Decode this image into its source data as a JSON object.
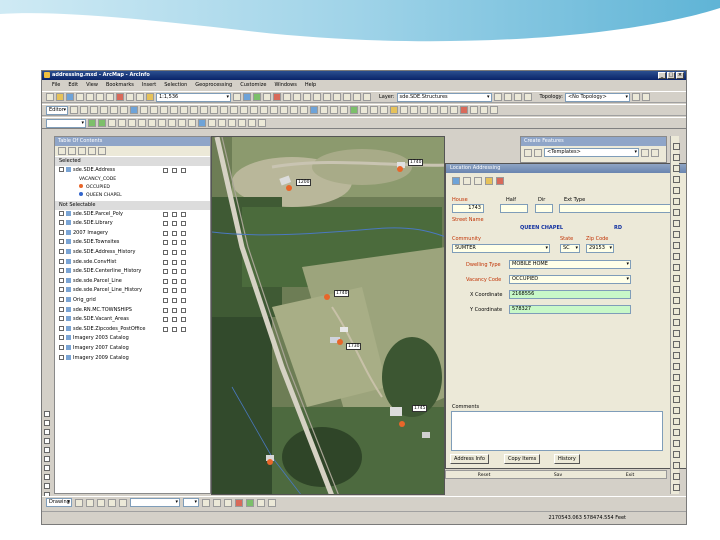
{
  "window": {
    "title": "addressing.mxd - ArcMap - ArcInfo"
  },
  "menu": [
    "File",
    "Edit",
    "View",
    "Bookmarks",
    "Insert",
    "Selection",
    "Geoprocessing",
    "Customize",
    "Windows",
    "Help"
  ],
  "toolbar": {
    "scale": "1:1,536",
    "layer_label": "Layer:",
    "layer_value": "sde.SDE.Structures",
    "topology_label": "Topology:",
    "topology_value": "<No Topology>",
    "editor_label": "Editor",
    "draw_label": "Drawing"
  },
  "toc": {
    "title": "Table Of Contents",
    "groups": [
      {
        "name": "Selected",
        "layers": [
          {
            "name": "sde.SDE.Address",
            "symbols": [
              "VACANCY_CODE",
              "OCCUPIED",
              "QUEEN CHAPEL"
            ]
          }
        ]
      },
      {
        "name": "Not Selectable",
        "layers": [
          {
            "name": "sde.SDE.Parcel_Poly"
          },
          {
            "name": "sde.SDE.Library"
          },
          {
            "name": "2007 Imagery"
          },
          {
            "name": "sde.SDE.Townsites"
          },
          {
            "name": "sde.SDE.Address_History"
          },
          {
            "name": "sde.sde.ConvHist"
          },
          {
            "name": "sde.SDE.Centerline_History"
          },
          {
            "name": "sde.sde.Parcel_Line"
          },
          {
            "name": "sde.sde.Parcel_Line_History"
          },
          {
            "name": "Orig_grid"
          },
          {
            "name": "sde.RN.MC.TOWNSHIPS"
          },
          {
            "name": "sde.SDE.Vacant_Areas"
          },
          {
            "name": "sde.SDE.Zipcodes_PostOffice"
          },
          {
            "name": "Imagery 2003 Catalog"
          },
          {
            "name": "Imagery 2007 Catalog"
          },
          {
            "name": "Imagery 2009 Catalog"
          }
        ]
      }
    ]
  },
  "catalog": {
    "title": "Create Features",
    "dropdown": "<Templates>"
  },
  "map": {
    "address_tags": [
      "1200",
      "1740",
      "1740",
      "1730",
      "1745"
    ]
  },
  "form": {
    "title": "Location Addressing",
    "house_label": "House",
    "house_value": "1743",
    "half_label": "Half",
    "dir_label": "Dir",
    "street_type_label": "Ext Type",
    "street_name_label": "Street Name",
    "street_name_value": "QUEEN CHAPEL",
    "street_suffix_value": "RD",
    "community_label": "Community",
    "state_label": "State",
    "zip_label": "Zip Code",
    "community_value": "SUMTER",
    "state_value": "SC",
    "zip_value": "29153",
    "dwelling_label": "Dwelling Type",
    "dwelling_value": "MOBILE HOME",
    "vacancy_label": "Vacancy Code",
    "vacancy_value": "OCCUPIED",
    "xcoord_label": "X Coordinate",
    "xcoord_value": "2168556",
    "ycoord_label": "Y Coordinate",
    "ycoord_value": "578327",
    "comments_label": "Comments",
    "btn_address": "Address Info",
    "btn_copy": "Copy Items",
    "btn_history": "History",
    "footer_left": "Reset",
    "footer_mid": "Sav",
    "footer_right": "Exit"
  },
  "status": {
    "coords": "2170543.063  578474.554 Feet"
  },
  "colors": {
    "title_bar": "#0a246a",
    "form_label": "#c03000",
    "coord_field": "#c8f8c8"
  }
}
